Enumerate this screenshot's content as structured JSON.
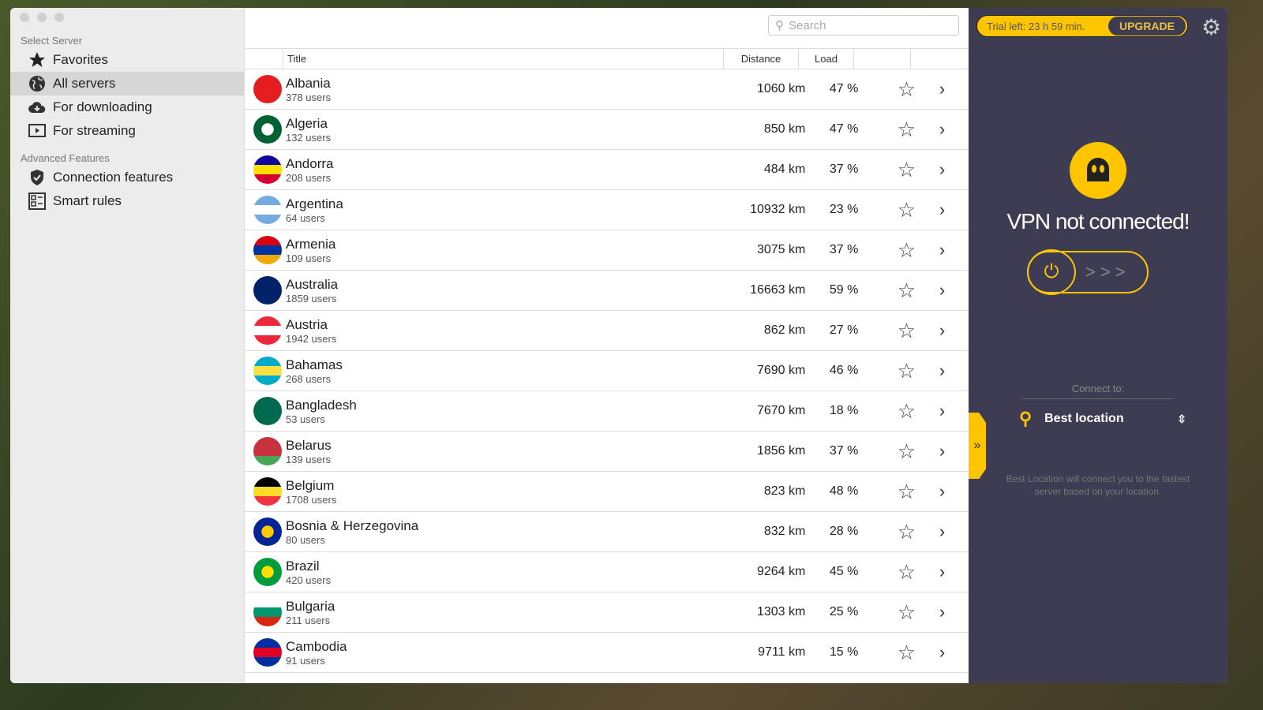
{
  "sidebar": {
    "section1": "Select Server",
    "items": [
      {
        "label": "Favorites",
        "icon": "star-icon"
      },
      {
        "label": "All servers",
        "icon": "globe-icon",
        "active": true
      },
      {
        "label": "For downloading",
        "icon": "cloud-download-icon"
      },
      {
        "label": "For streaming",
        "icon": "play-icon"
      }
    ],
    "section2": "Advanced Features",
    "items2": [
      {
        "label": "Connection features",
        "icon": "shield-icon"
      },
      {
        "label": "Smart rules",
        "icon": "rules-icon"
      }
    ]
  },
  "search": {
    "placeholder": "Search"
  },
  "table": {
    "headers": {
      "title": "Title",
      "distance": "Distance",
      "load": "Load"
    },
    "rows": [
      {
        "name": "Albania",
        "users": "378 users",
        "distance": "1060 km",
        "load": "47 %",
        "flag": [
          "#e41e20",
          "#e41e20"
        ]
      },
      {
        "name": "Algeria",
        "users": "132 users",
        "distance": "850 km",
        "load": "47 %",
        "flag": [
          "#006233",
          "#ffffff"
        ]
      },
      {
        "name": "Andorra",
        "users": "208 users",
        "distance": "484 km",
        "load": "37 %",
        "flag": [
          "#10069f",
          "#fedf00",
          "#d50032"
        ]
      },
      {
        "name": "Argentina",
        "users": "64 users",
        "distance": "10932 km",
        "load": "23 %",
        "flag": [
          "#74acdf",
          "#ffffff",
          "#74acdf"
        ]
      },
      {
        "name": "Armenia",
        "users": "109 users",
        "distance": "3075 km",
        "load": "37 %",
        "flag": [
          "#d90012",
          "#0033a0",
          "#f2a800"
        ]
      },
      {
        "name": "Australia",
        "users": "1859 users",
        "distance": "16663 km",
        "load": "59 %",
        "flag": [
          "#012169",
          "#012169"
        ]
      },
      {
        "name": "Austria",
        "users": "1942 users",
        "distance": "862 km",
        "load": "27 %",
        "flag": [
          "#ed2939",
          "#ffffff",
          "#ed2939"
        ]
      },
      {
        "name": "Bahamas",
        "users": "268 users",
        "distance": "7690 km",
        "load": "46 %",
        "flag": [
          "#00abc9",
          "#fae042",
          "#00abc9"
        ]
      },
      {
        "name": "Bangladesh",
        "users": "53 users",
        "distance": "7670 km",
        "load": "18 %",
        "flag": [
          "#006a4e",
          "#006a4e"
        ]
      },
      {
        "name": "Belarus",
        "users": "139 users",
        "distance": "1856 km",
        "load": "37 %",
        "flag": [
          "#c8313e",
          "#c8313e",
          "#4aa657"
        ]
      },
      {
        "name": "Belgium",
        "users": "1708 users",
        "distance": "823 km",
        "load": "48 %",
        "flag": [
          "#000000",
          "#fdda24",
          "#ef3340"
        ]
      },
      {
        "name": "Bosnia & Herzegovina",
        "users": "80 users",
        "distance": "832 km",
        "load": "28 %",
        "flag": [
          "#002395",
          "#fecb00"
        ]
      },
      {
        "name": "Brazil",
        "users": "420 users",
        "distance": "9264 km",
        "load": "45 %",
        "flag": [
          "#009c3b",
          "#ffdf00"
        ]
      },
      {
        "name": "Bulgaria",
        "users": "211 users",
        "distance": "1303 km",
        "load": "25 %",
        "flag": [
          "#ffffff",
          "#00966e",
          "#d62612"
        ]
      },
      {
        "name": "Cambodia",
        "users": "91 users",
        "distance": "9711 km",
        "load": "15 %",
        "flag": [
          "#032ea1",
          "#e00025",
          "#032ea1"
        ]
      }
    ]
  },
  "panel": {
    "trial": "Trial left: 23 h 59 min.",
    "upgrade": "UPGRADE",
    "status": "VPN not connected!",
    "connect_to": "Connect to:",
    "location": "Best location",
    "hint": "Best Location will connect you to the fastest server based on your location.",
    "accent": "#fcc500",
    "bg": "#3d3c52"
  }
}
